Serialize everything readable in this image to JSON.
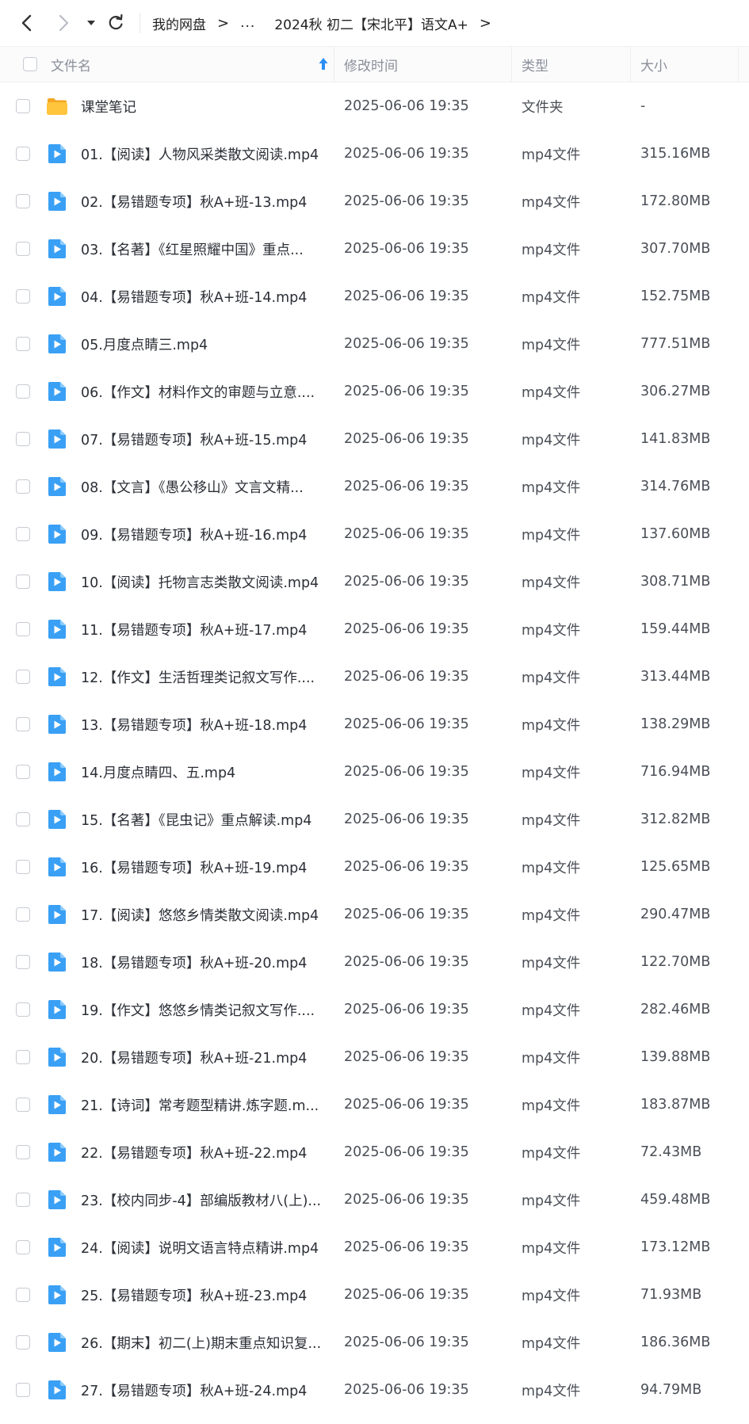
{
  "nav": {
    "back_icon": "chevron-left-icon",
    "forward_icon": "chevron-right-icon",
    "dropdown_icon": "caret-down-icon",
    "refresh_icon": "refresh-icon"
  },
  "breadcrumb": {
    "root": "我的网盘",
    "ellipsis": "...",
    "current": "2024秋 初二【宋北平】语文A+",
    "separator": ">"
  },
  "columns": {
    "name": "文件名",
    "time": "修改时间",
    "type": "类型",
    "size": "大小"
  },
  "colors": {
    "video_icon": "#3aa0f5",
    "folder_icon": "#ffc53d",
    "sort_arrow": "#2a8ef5"
  },
  "files": [
    {
      "name": "课堂笔记",
      "time": "2025-06-06 19:35",
      "type": "文件夹",
      "size": "-",
      "icon": "folder-icon"
    },
    {
      "name": "01.【阅读】人物风采类散文阅读.mp4",
      "time": "2025-06-06 19:35",
      "type": "mp4文件",
      "size": "315.16MB",
      "icon": "video-file-icon"
    },
    {
      "name": "02.【易错题专项】秋A+班-13.mp4",
      "time": "2025-06-06 19:35",
      "type": "mp4文件",
      "size": "172.80MB",
      "icon": "video-file-icon"
    },
    {
      "name": "03.【名著】《红星照耀中国》重点...",
      "time": "2025-06-06 19:35",
      "type": "mp4文件",
      "size": "307.70MB",
      "icon": "video-file-icon"
    },
    {
      "name": "04.【易错题专项】秋A+班-14.mp4",
      "time": "2025-06-06 19:35",
      "type": "mp4文件",
      "size": "152.75MB",
      "icon": "video-file-icon"
    },
    {
      "name": "05.月度点睛三.mp4",
      "time": "2025-06-06 19:35",
      "type": "mp4文件",
      "size": "777.51MB",
      "icon": "video-file-icon"
    },
    {
      "name": "06.【作文】材料作文的审题与立意....",
      "time": "2025-06-06 19:35",
      "type": "mp4文件",
      "size": "306.27MB",
      "icon": "video-file-icon"
    },
    {
      "name": "07.【易错题专项】秋A+班-15.mp4",
      "time": "2025-06-06 19:35",
      "type": "mp4文件",
      "size": "141.83MB",
      "icon": "video-file-icon"
    },
    {
      "name": "08.【文言】《愚公移山》文言文精...",
      "time": "2025-06-06 19:35",
      "type": "mp4文件",
      "size": "314.76MB",
      "icon": "video-file-icon"
    },
    {
      "name": "09.【易错题专项】秋A+班-16.mp4",
      "time": "2025-06-06 19:35",
      "type": "mp4文件",
      "size": "137.60MB",
      "icon": "video-file-icon"
    },
    {
      "name": "10.【阅读】托物言志类散文阅读.mp4",
      "time": "2025-06-06 19:35",
      "type": "mp4文件",
      "size": "308.71MB",
      "icon": "video-file-icon"
    },
    {
      "name": "11.【易错题专项】秋A+班-17.mp4",
      "time": "2025-06-06 19:35",
      "type": "mp4文件",
      "size": "159.44MB",
      "icon": "video-file-icon"
    },
    {
      "name": "12.【作文】生活哲理类记叙文写作....",
      "time": "2025-06-06 19:35",
      "type": "mp4文件",
      "size": "313.44MB",
      "icon": "video-file-icon"
    },
    {
      "name": "13.【易错题专项】秋A+班-18.mp4",
      "time": "2025-06-06 19:35",
      "type": "mp4文件",
      "size": "138.29MB",
      "icon": "video-file-icon"
    },
    {
      "name": "14.月度点睛四、五.mp4",
      "time": "2025-06-06 19:35",
      "type": "mp4文件",
      "size": "716.94MB",
      "icon": "video-file-icon"
    },
    {
      "name": "15.【名著】《昆虫记》重点解读.mp4",
      "time": "2025-06-06 19:35",
      "type": "mp4文件",
      "size": "312.82MB",
      "icon": "video-file-icon"
    },
    {
      "name": "16.【易错题专项】秋A+班-19.mp4",
      "time": "2025-06-06 19:35",
      "type": "mp4文件",
      "size": "125.65MB",
      "icon": "video-file-icon"
    },
    {
      "name": "17.【阅读】悠悠乡情类散文阅读.mp4",
      "time": "2025-06-06 19:35",
      "type": "mp4文件",
      "size": "290.47MB",
      "icon": "video-file-icon"
    },
    {
      "name": "18.【易错题专项】秋A+班-20.mp4",
      "time": "2025-06-06 19:35",
      "type": "mp4文件",
      "size": "122.70MB",
      "icon": "video-file-icon"
    },
    {
      "name": "19.【作文】悠悠乡情类记叙文写作....",
      "time": "2025-06-06 19:35",
      "type": "mp4文件",
      "size": "282.46MB",
      "icon": "video-file-icon"
    },
    {
      "name": "20.【易错题专项】秋A+班-21.mp4",
      "time": "2025-06-06 19:35",
      "type": "mp4文件",
      "size": "139.88MB",
      "icon": "video-file-icon"
    },
    {
      "name": "21.【诗词】常考题型精讲.炼字题.m...",
      "time": "2025-06-06 19:35",
      "type": "mp4文件",
      "size": "183.87MB",
      "icon": "video-file-icon"
    },
    {
      "name": "22.【易错题专项】秋A+班-22.mp4",
      "time": "2025-06-06 19:35",
      "type": "mp4文件",
      "size": "72.43MB",
      "icon": "video-file-icon"
    },
    {
      "name": "23.【校内同步-4】部编版教材八(上)...",
      "time": "2025-06-06 19:35",
      "type": "mp4文件",
      "size": "459.48MB",
      "icon": "video-file-icon"
    },
    {
      "name": "24.【阅读】说明文语言特点精讲.mp4",
      "time": "2025-06-06 19:35",
      "type": "mp4文件",
      "size": "173.12MB",
      "icon": "video-file-icon"
    },
    {
      "name": "25.【易错题专项】秋A+班-23.mp4",
      "time": "2025-06-06 19:35",
      "type": "mp4文件",
      "size": "71.93MB",
      "icon": "video-file-icon"
    },
    {
      "name": "26.【期末】初二(上)期末重点知识复...",
      "time": "2025-06-06 19:35",
      "type": "mp4文件",
      "size": "186.36MB",
      "icon": "video-file-icon"
    },
    {
      "name": "27.【易错题专项】秋A+班-24.mp4",
      "time": "2025-06-06 19:35",
      "type": "mp4文件",
      "size": "94.79MB",
      "icon": "video-file-icon"
    }
  ]
}
